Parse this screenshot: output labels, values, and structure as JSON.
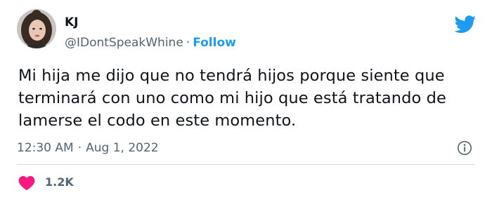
{
  "author": {
    "name": "KJ",
    "handle": "@IDontSpeakWhine",
    "separator": "·",
    "follow_label": "Follow"
  },
  "tweet": {
    "text": "Mi hija me dijo que no tendrá hijos porque siente que terminará con uno como mi hijo que está tratando de lamerse el codo en este momento."
  },
  "meta": {
    "time": "12:30 AM",
    "separator": "·",
    "date": "Aug 1, 2022"
  },
  "engagement": {
    "likes": "1.2K"
  },
  "icons": {
    "brand": "twitter-bird-icon",
    "info": "info-icon",
    "like": "heart-icon"
  },
  "colors": {
    "accent": "#1d9bf0",
    "heart": "#f91880",
    "text": "#0f1419",
    "muted": "#536471",
    "divider": "#cfd9de"
  }
}
